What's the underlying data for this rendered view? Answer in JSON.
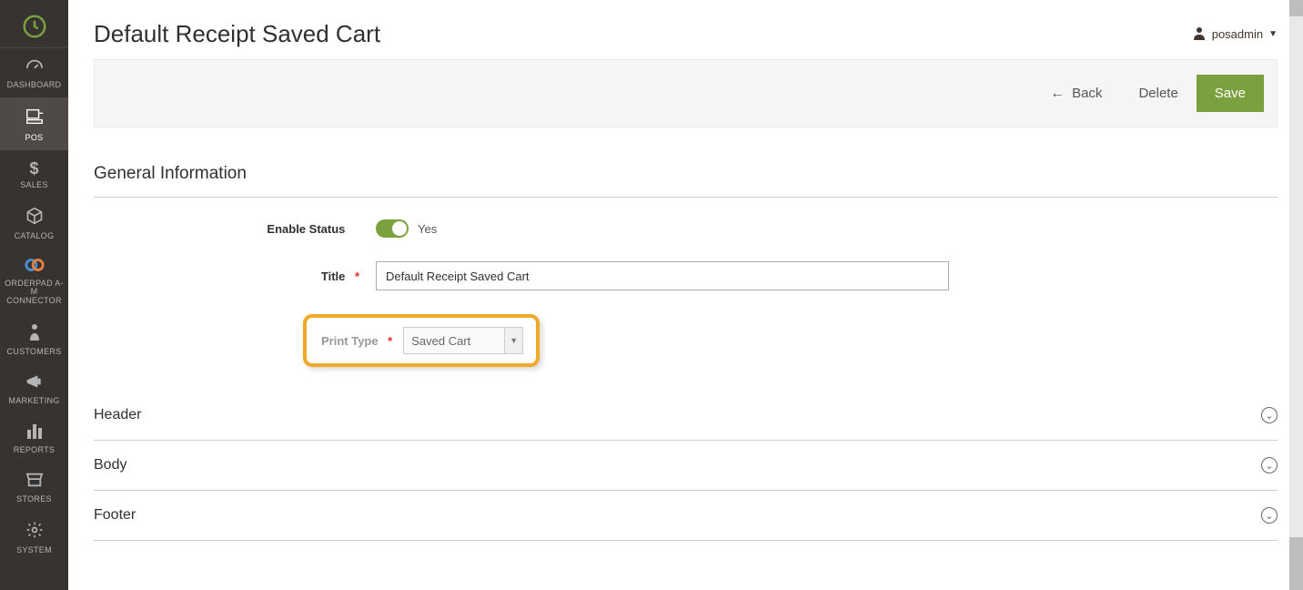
{
  "sidebar": {
    "items": [
      {
        "label": "DASHBOARD"
      },
      {
        "label": "POS"
      },
      {
        "label": "SALES"
      },
      {
        "label": "CATALOG"
      },
      {
        "label": "ORDERPAD A-M CONNECTOR"
      },
      {
        "label": "CUSTOMERS"
      },
      {
        "label": "MARKETING"
      },
      {
        "label": "REPORTS"
      },
      {
        "label": "STORES"
      },
      {
        "label": "SYSTEM"
      }
    ]
  },
  "header": {
    "page_title": "Default Receipt Saved Cart",
    "user_name": "posadmin"
  },
  "toolbar": {
    "back_label": "Back",
    "delete_label": "Delete",
    "save_label": "Save"
  },
  "general": {
    "section_title": "General Information",
    "enable_status_label": "Enable Status",
    "enable_status_value": "Yes",
    "title_label": "Title",
    "title_value": "Default Receipt Saved Cart",
    "print_type_label": "Print Type",
    "print_type_value": "Saved Cart"
  },
  "accordions": {
    "header": "Header",
    "body": "Body",
    "footer": "Footer"
  }
}
